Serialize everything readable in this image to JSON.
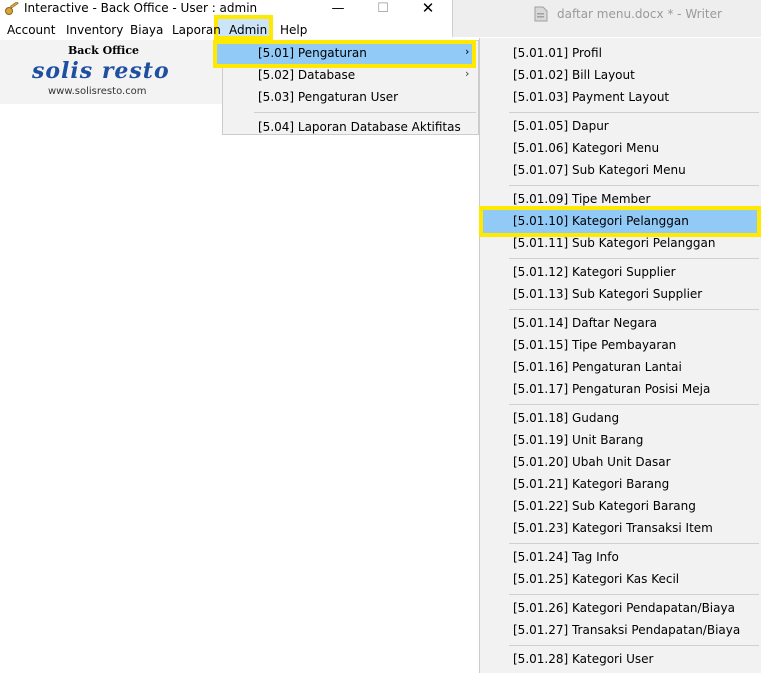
{
  "window": {
    "title": "Interactive - Back Office - User : admin",
    "controls": {
      "minimize": "—",
      "maximize": "☐",
      "close": "✕"
    }
  },
  "other_window": {
    "title": "daftar menu.docx * - Writer"
  },
  "menubar": {
    "items": [
      "Account",
      "Inventory",
      "Biaya",
      "Laporan",
      "Admin",
      "Help"
    ],
    "active": "Admin"
  },
  "logo": {
    "heading": "Back Office",
    "name": "solis resto",
    "url": "www.solisresto.com"
  },
  "admin_menu": {
    "items": [
      "[5.01] Pengaturan",
      "[5.02] Database",
      "[5.03] Pengaturan User",
      "[5.04] Laporan Database Aktifitas"
    ],
    "highlighted": "[5.01] Pengaturan",
    "submenu_arrow": "›"
  },
  "pengaturan_menu": {
    "items": [
      "[5.01.01] Profil",
      "[5.01.02] Bill Layout",
      "[5.01.03] Payment Layout",
      "[5.01.05] Dapur",
      "[5.01.06] Kategori Menu",
      "[5.01.07] Sub Kategori Menu",
      "[5.01.09] Tipe Member",
      "[5.01.10] Kategori Pelanggan",
      "[5.01.11] Sub Kategori Pelanggan",
      "[5.01.12] Kategori Supplier",
      "[5.01.13] Sub Kategori Supplier",
      "[5.01.14] Daftar Negara",
      "[5.01.15] Tipe Pembayaran",
      "[5.01.16] Pengaturan Lantai",
      "[5.01.17] Pengaturan Posisi Meja",
      "[5.01.18] Gudang",
      "[5.01.19] Unit Barang",
      "[5.01.20] Ubah Unit Dasar",
      "[5.01.21] Kategori Barang",
      "[5.01.22] Sub Kategori Barang",
      "[5.01.23] Kategori Transaksi Item",
      "[5.01.24] Tag Info",
      "[5.01.25] Kategori Kas Kecil",
      "[5.01.26] Kategori Pendapatan/Biaya",
      "[5.01.27] Transaksi Pendapatan/Biaya",
      "[5.01.28] Kategori User"
    ],
    "highlighted": "[5.01.10] Kategori Pelanggan"
  },
  "colors": {
    "highlight_border": "#ffe900",
    "menu_highlight": "#91c9f7",
    "menu_background": "#f2f2f2",
    "logo_blue": "#1e4fa0"
  }
}
